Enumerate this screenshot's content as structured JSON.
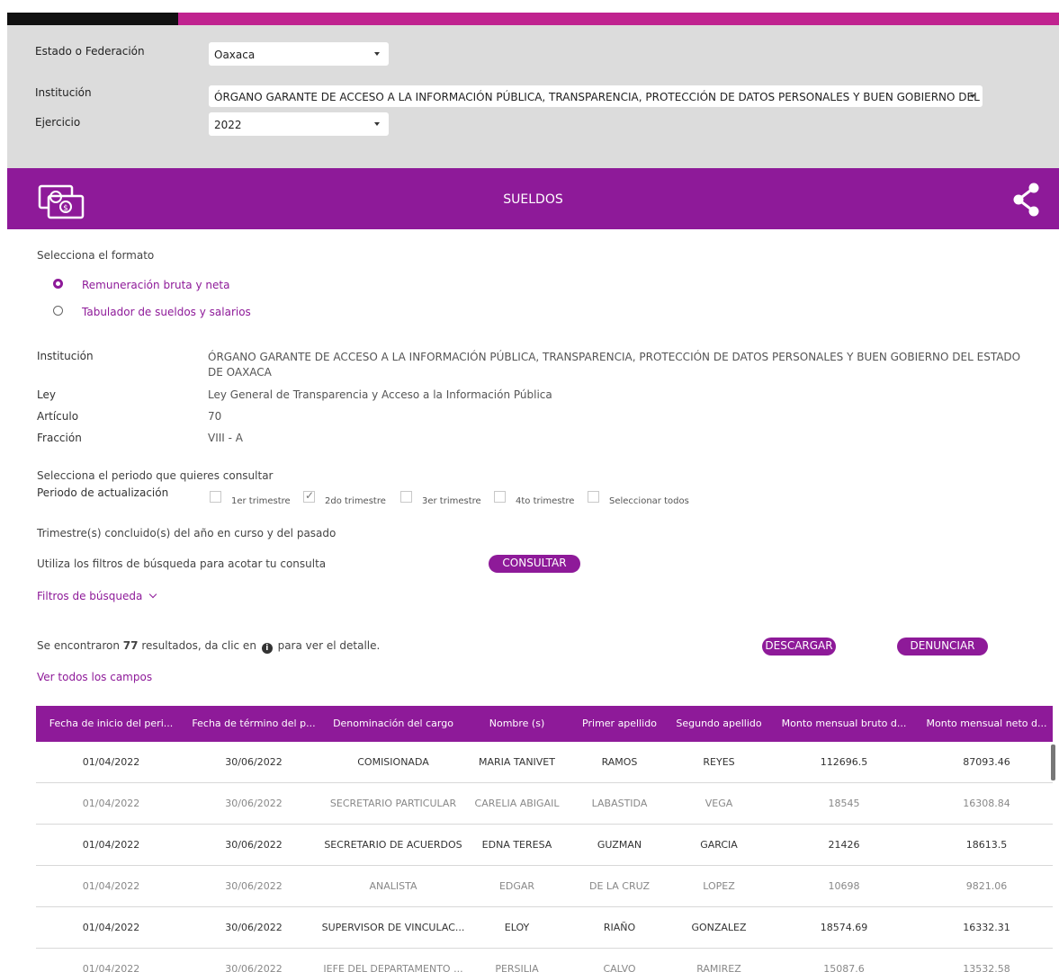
{
  "filters": {
    "estado_label": "Estado o Federación",
    "estado_value": "Oaxaca",
    "institucion_label": "Institución",
    "institucion_value": "ÓRGANO GARANTE DE ACCESO A LA INFORMACIÓN PÚBLICA, TRANSPARENCIA, PROTECCIÓN DE DATOS PERSONALES Y BUEN GOBIERNO DEL",
    "ejercicio_label": "Ejercicio",
    "ejercicio_value": "2022"
  },
  "banner": {
    "title": "SUELDOS",
    "money_icon": "money-bills-icon",
    "share_icon": "share-icon"
  },
  "formato": {
    "label": "Selecciona el formato",
    "options": [
      {
        "label": "Remuneración bruta y neta",
        "selected": true
      },
      {
        "label": "Tabulador de sueldos y salarios",
        "selected": false
      }
    ]
  },
  "info": {
    "institucion_label": "Institución",
    "institucion_value": "ÓRGANO GARANTE DE ACCESO A LA INFORMACIÓN PÚBLICA, TRANSPARENCIA, PROTECCIÓN DE DATOS PERSONALES Y BUEN GOBIERNO DEL ESTADO DE OAXACA",
    "ley_label": "Ley",
    "ley_value": "Ley General de Transparencia y Acceso a la Información Pública",
    "articulo_label": "Artículo",
    "articulo_value": "70",
    "fraccion_label": "Fracción",
    "fraccion_value": "VIII - A"
  },
  "periodo": {
    "prompt": "Selecciona el periodo que quieres consultar",
    "label": "Periodo de actualización",
    "options": [
      {
        "label": "1er trimestre",
        "checked": false
      },
      {
        "label": "2do trimestre",
        "checked": true
      },
      {
        "label": "3er trimestre",
        "checked": false
      },
      {
        "label": "4to trimestre",
        "checked": false
      },
      {
        "label": "Seleccionar todos",
        "checked": false
      }
    ],
    "note": "Trimestre(s) concluido(s) del año en curso y del pasado"
  },
  "consulta": {
    "hint": "Utiliza los filtros de búsqueda para acotar tu consulta",
    "button": "CONSULTAR",
    "filtros_link": "Filtros de búsqueda"
  },
  "results": {
    "prefix": "Se encontraron",
    "count": "77",
    "middle": "resultados, da clic en",
    "suffix": "para ver el detalle.",
    "info_icon": "info-icon",
    "download": "DESCARGAR",
    "report": "DENUNCIAR",
    "all_fields": "Ver todos los campos"
  },
  "table": {
    "headers": [
      "Fecha de inicio del peri...",
      "Fecha de término del p...",
      "Denominación del cargo",
      "Nombre (s)",
      "Primer apellido",
      "Segundo apellido",
      "Monto mensual bruto d...",
      "Monto mensual neto d..."
    ],
    "rows": [
      [
        "01/04/2022",
        "30/06/2022",
        "COMISIONADA",
        "MARIA TANIVET",
        "RAMOS",
        "REYES",
        "112696.5",
        "87093.46"
      ],
      [
        "01/04/2022",
        "30/06/2022",
        "SECRETARIO PARTICULAR",
        "CARELIA ABIGAIL",
        "LABASTIDA",
        "VEGA",
        "18545",
        "16308.84"
      ],
      [
        "01/04/2022",
        "30/06/2022",
        "SECRETARIO DE ACUERDOS",
        "EDNA TERESA",
        "GUZMAN",
        "GARCIA",
        "21426",
        "18613.5"
      ],
      [
        "01/04/2022",
        "30/06/2022",
        "ANALISTA",
        "EDGAR",
        "DE LA CRUZ",
        "LOPEZ",
        "10698",
        "9821.06"
      ],
      [
        "01/04/2022",
        "30/06/2022",
        "SUPERVISOR DE VINCULAC...",
        "ELOY",
        "RIAÑO",
        "GONZALEZ",
        "18574.69",
        "16332.31"
      ],
      [
        "01/04/2022",
        "30/06/2022",
        "JEFE DEL DEPARTAMENTO ...",
        "PERSILIA",
        "CALVO",
        "RAMIREZ",
        "15087.6",
        "13532.58"
      ]
    ]
  },
  "colors": {
    "brand_purple": "#8e1a99",
    "brand_magenta": "#c0238f",
    "filter_bg": "#dcdcdc"
  }
}
